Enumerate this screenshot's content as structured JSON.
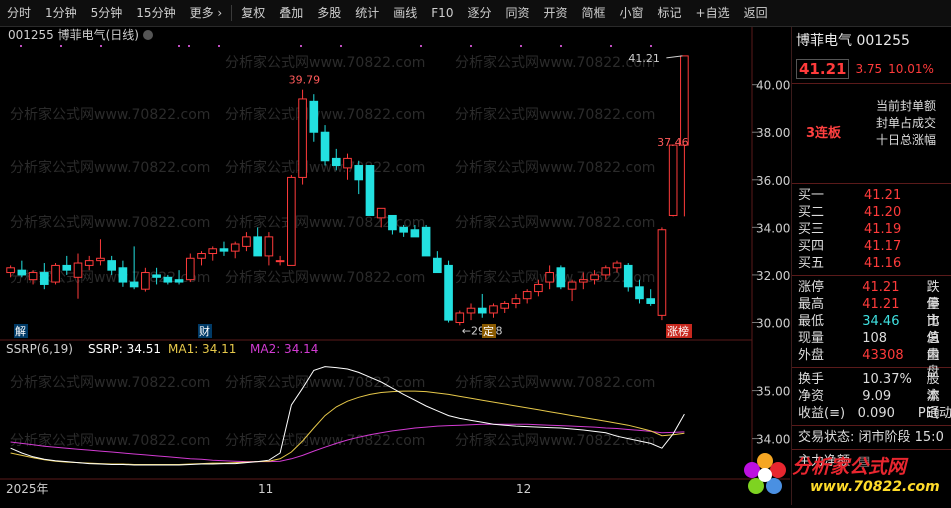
{
  "toolbar": {
    "items": [
      "分时",
      "1分钟",
      "5分钟",
      "15分钟",
      "更多 ›",
      "复权",
      "叠加",
      "多股",
      "统计",
      "画线",
      "F10",
      "逐分",
      "同资",
      "开资",
      "简框",
      "小窗",
      "标记",
      "+自选",
      "返回"
    ]
  },
  "main_chart": {
    "title": "001255  博菲电气(日线)",
    "y_ticks": [
      "40.00",
      "38.00",
      "36.00",
      "34.00",
      "32.00",
      "30.00"
    ],
    "high_label": "39.79",
    "low_label": "←29.88",
    "last_high_label": "41.21",
    "mid_label": "37.46",
    "markers": [
      "解",
      "财",
      "定",
      "涨榜"
    ],
    "watermark": "分析家公式网www.70822.com"
  },
  "indicator": {
    "name": "SSRP(6,19)",
    "ssrp": "SSRP: 34.51",
    "ma1": "MA1: 34.11",
    "ma2": "MA2: 34.14",
    "y_ticks": [
      "35.00",
      "34.00"
    ]
  },
  "x_axis": {
    "labels": [
      "2025年",
      "11",
      "12"
    ]
  },
  "quote": {
    "name": "博菲电气 001255",
    "price": "41.21",
    "change": "3.75",
    "pct": "10.01%",
    "limit_board": "3连板",
    "limit_items": [
      "当前封单额",
      "封单占成交",
      "十日总涨幅"
    ],
    "bids": [
      {
        "label": "买一",
        "value": "41.21"
      },
      {
        "label": "买二",
        "value": "41.20"
      },
      {
        "label": "买三",
        "value": "41.19"
      },
      {
        "label": "买四",
        "value": "41.17"
      },
      {
        "label": "买五",
        "value": "41.16"
      }
    ],
    "stats": [
      {
        "label": "涨停",
        "value": "41.21",
        "label2": "跌停",
        "color": "red"
      },
      {
        "label": "最高",
        "value": "41.21",
        "label2": "量比",
        "color": "red"
      },
      {
        "label": "最低",
        "value": "34.46",
        "label2": "市值",
        "color": "cyan"
      },
      {
        "label": "现量",
        "value": "108",
        "label2": "总量",
        "color": "white"
      },
      {
        "label": "外盘",
        "value": "43308",
        "label2": "内盘",
        "color": "red"
      }
    ],
    "stats2": [
      {
        "label": "换手",
        "value": "10.37%",
        "label2": "股本"
      },
      {
        "label": "净资",
        "value": "9.09",
        "label2": "流通"
      },
      {
        "label": "收益(≡)",
        "value": "0.090",
        "label2": "PE(动"
      }
    ],
    "trade_state": "交易状态: 闭市阶段 15:0",
    "main_flow": "主力净额"
  },
  "logo": {
    "main": "分析家公式网",
    "url": "www.70822.com"
  },
  "chart_data": {
    "type": "candlestick",
    "ylim": [
      29.6,
      41.5
    ],
    "candles": [
      [
        32.1,
        32.4,
        31.9,
        32.3
      ],
      [
        32.2,
        32.6,
        31.9,
        32.0
      ],
      [
        31.8,
        32.2,
        31.6,
        32.1
      ],
      [
        32.1,
        32.5,
        31.4,
        31.6
      ],
      [
        31.7,
        32.5,
        31.6,
        32.4
      ],
      [
        32.4,
        32.8,
        32.0,
        32.2
      ],
      [
        31.9,
        32.9,
        31.0,
        32.5
      ],
      [
        32.4,
        32.8,
        32.2,
        32.6
      ],
      [
        32.6,
        33.5,
        32.4,
        32.7
      ],
      [
        32.6,
        32.8,
        32.0,
        32.2
      ],
      [
        32.3,
        32.6,
        31.5,
        31.7
      ],
      [
        31.7,
        33.2,
        31.4,
        31.5
      ],
      [
        31.4,
        32.3,
        31.3,
        32.1
      ],
      [
        32.0,
        32.3,
        31.6,
        31.9
      ],
      [
        31.9,
        32.0,
        31.6,
        31.7
      ],
      [
        31.8,
        32.2,
        31.6,
        31.7
      ],
      [
        31.8,
        32.9,
        31.7,
        32.7
      ],
      [
        32.7,
        33.0,
        32.4,
        32.9
      ],
      [
        32.9,
        33.2,
        32.6,
        33.1
      ],
      [
        33.1,
        33.4,
        32.8,
        33.0
      ],
      [
        33.0,
        33.4,
        32.7,
        33.3
      ],
      [
        33.2,
        33.8,
        33.0,
        33.6
      ],
      [
        33.6,
        34.0,
        32.8,
        32.8
      ],
      [
        32.8,
        33.8,
        32.4,
        33.6
      ],
      [
        32.6,
        32.8,
        32.4,
        32.6
      ],
      [
        32.4,
        36.2,
        32.4,
        36.1
      ],
      [
        36.1,
        39.79,
        35.8,
        39.4
      ],
      [
        39.3,
        39.6,
        37.6,
        38.0
      ],
      [
        38.0,
        38.3,
        36.6,
        36.8
      ],
      [
        36.9,
        37.3,
        36.4,
        36.6
      ],
      [
        36.5,
        37.1,
        36.0,
        36.9
      ],
      [
        36.6,
        36.8,
        35.4,
        36.0
      ],
      [
        36.6,
        36.6,
        34.5,
        34.5
      ],
      [
        34.4,
        34.8,
        34.0,
        34.8
      ],
      [
        34.5,
        34.5,
        33.7,
        33.9
      ],
      [
        34.0,
        34.1,
        33.6,
        33.8
      ],
      [
        33.9,
        34.1,
        33.6,
        33.6
      ],
      [
        34.0,
        34.1,
        32.8,
        32.8
      ],
      [
        32.7,
        33.0,
        32.1,
        32.1
      ],
      [
        32.4,
        32.6,
        30.0,
        30.1
      ],
      [
        30.0,
        30.5,
        29.88,
        30.4
      ],
      [
        30.4,
        30.8,
        30.1,
        30.6
      ],
      [
        30.6,
        31.2,
        30.2,
        30.4
      ],
      [
        30.4,
        30.8,
        30.2,
        30.7
      ],
      [
        30.6,
        30.9,
        30.4,
        30.8
      ],
      [
        30.8,
        31.2,
        30.6,
        31.0
      ],
      [
        31.0,
        31.4,
        30.8,
        31.3
      ],
      [
        31.3,
        31.8,
        31.1,
        31.6
      ],
      [
        31.7,
        32.4,
        31.4,
        32.1
      ],
      [
        32.3,
        32.4,
        31.4,
        31.5
      ],
      [
        31.4,
        31.8,
        30.9,
        31.7
      ],
      [
        31.7,
        32.1,
        31.4,
        31.8
      ],
      [
        31.8,
        32.2,
        31.6,
        32.0
      ],
      [
        32.0,
        32.4,
        31.8,
        32.3
      ],
      [
        32.3,
        32.6,
        32.1,
        32.5
      ],
      [
        32.4,
        32.5,
        31.3,
        31.5
      ],
      [
        31.5,
        31.8,
        30.8,
        31.0
      ],
      [
        31.0,
        31.4,
        30.7,
        30.8
      ],
      [
        30.3,
        34.0,
        30.1,
        33.9
      ],
      [
        34.5,
        37.46,
        34.46,
        37.46
      ],
      [
        37.46,
        41.21,
        34.46,
        41.21
      ]
    ],
    "ssrp_ylim": [
      33.2,
      35.7
    ],
    "ssrp": [
      33.8,
      33.7,
      33.62,
      33.57,
      33.54,
      33.52,
      33.5,
      33.48,
      33.47,
      33.46,
      33.46,
      33.45,
      33.45,
      33.45,
      33.45,
      33.45,
      33.46,
      33.47,
      33.47,
      33.48,
      33.48,
      33.5,
      33.52,
      33.55,
      33.7,
      34.7,
      35.05,
      35.42,
      35.5,
      35.48,
      35.45,
      35.38,
      35.28,
      35.18,
      35.05,
      34.92,
      34.8,
      34.68,
      34.58,
      34.48,
      34.42,
      34.38,
      34.34,
      34.3,
      34.28,
      34.26,
      34.25,
      34.24,
      34.23,
      34.22,
      34.2,
      34.18,
      34.15,
      34.12,
      34.05,
      34.0,
      33.95,
      33.9,
      33.8,
      34.1,
      34.51
    ],
    "ma1": [
      33.7,
      33.65,
      33.6,
      33.56,
      33.53,
      33.51,
      33.5,
      33.49,
      33.48,
      33.47,
      33.47,
      33.46,
      33.46,
      33.46,
      33.46,
      33.46,
      33.47,
      33.48,
      33.49,
      33.49,
      33.5,
      33.51,
      33.52,
      33.53,
      33.58,
      33.72,
      33.95,
      34.22,
      34.48,
      34.66,
      34.78,
      34.86,
      34.92,
      34.96,
      34.98,
      34.99,
      34.99,
      34.98,
      34.95,
      34.92,
      34.88,
      34.84,
      34.8,
      34.76,
      34.72,
      34.68,
      34.64,
      34.6,
      34.56,
      34.52,
      34.48,
      34.44,
      34.4,
      34.36,
      34.32,
      34.28,
      34.22,
      34.16,
      34.06,
      34.08,
      34.11
    ],
    "ma2": [
      33.93,
      33.9,
      33.87,
      33.84,
      33.82,
      33.8,
      33.78,
      33.76,
      33.74,
      33.72,
      33.7,
      33.68,
      33.66,
      33.64,
      33.62,
      33.6,
      33.58,
      33.57,
      33.55,
      33.54,
      33.53,
      33.52,
      33.52,
      33.52,
      33.53,
      33.58,
      33.65,
      33.74,
      33.82,
      33.9,
      33.97,
      34.03,
      34.08,
      34.12,
      34.16,
      34.19,
      34.22,
      34.24,
      34.26,
      34.27,
      34.28,
      34.29,
      34.3,
      34.3,
      34.3,
      34.3,
      34.3,
      34.29,
      34.28,
      34.27,
      34.26,
      34.25,
      34.24,
      34.22,
      34.21,
      34.19,
      34.17,
      34.15,
      34.12,
      34.13,
      34.14
    ],
    "colors": {
      "up": "#ff3b3b",
      "down": "#23e0e0",
      "ssrp": "#ffffff",
      "ma1": "#e6c84a",
      "ma2": "#d23bd2"
    }
  }
}
